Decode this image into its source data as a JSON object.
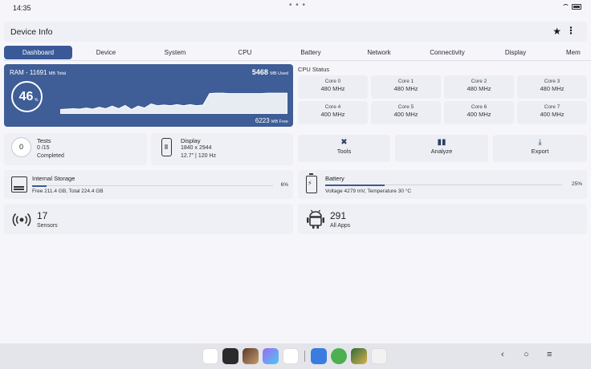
{
  "status_bar": {
    "time": "14:35",
    "dots": "• • •"
  },
  "app_bar": {
    "title": "Device Info",
    "star_icon": "star-icon",
    "more_icon": "more-vert-icon"
  },
  "tabs": [
    "Dashboard",
    "Device",
    "System",
    "CPU",
    "Battery",
    "Network",
    "Connectivity",
    "Display",
    "Mem"
  ],
  "ram": {
    "total_label": "RAM - 11691",
    "total_unit": "MB Total",
    "used_value": "5468",
    "used_unit": "MB Used",
    "free_value": "6223",
    "free_unit": "MB Free",
    "percent": "46",
    "percent_sign": "%",
    "usage_history_percent": [
      12,
      13,
      14,
      13,
      16,
      13,
      18,
      14,
      21,
      14,
      23,
      12,
      21,
      16,
      27,
      22,
      24,
      22,
      25,
      22,
      25,
      22,
      24,
      55,
      56,
      56,
      55,
      55,
      55,
      55,
      55,
      55,
      56,
      56,
      56,
      56
    ]
  },
  "cpu": {
    "title": "CPU Status",
    "cores": [
      {
        "name": "Core 0",
        "freq": "480 MHz"
      },
      {
        "name": "Core 1",
        "freq": "480 MHz"
      },
      {
        "name": "Core 2",
        "freq": "480 MHz"
      },
      {
        "name": "Core 3",
        "freq": "480 MHz"
      },
      {
        "name": "Core 4",
        "freq": "400 MHz"
      },
      {
        "name": "Core 5",
        "freq": "400 MHz"
      },
      {
        "name": "Core 6",
        "freq": "400 MHz"
      },
      {
        "name": "Core 7",
        "freq": "400 MHz"
      }
    ]
  },
  "tests": {
    "count": "0",
    "title": "Tests",
    "progress": "0 /15",
    "status": "Completed"
  },
  "display": {
    "title": "Display",
    "resolution": "1840 x 2944",
    "details": "12.7\" | 120 Hz"
  },
  "actions": [
    {
      "label": "Tools",
      "icon": "tools-icon"
    },
    {
      "label": "Analyze",
      "icon": "bar-chart-icon"
    },
    {
      "label": "Export",
      "icon": "download-icon"
    }
  ],
  "storage": {
    "title": "Internal Storage",
    "detail": "Free 211.4 GB, Total 224.4 GB",
    "percent_label": "6%",
    "fill": 0.06
  },
  "battery": {
    "title": "Battery",
    "detail": "Voltage 4279 mV, Temperature 30 °C",
    "percent_label": "25%",
    "fill": 0.25
  },
  "sensors": {
    "count": "17",
    "label": "Sensors"
  },
  "apps": {
    "count": "291",
    "label": "All Apps"
  },
  "nav": {
    "back": "‹",
    "home": "○",
    "menu": "≡"
  },
  "colors": {
    "accent": "#3a5a97",
    "ram_card": "#3f5d96",
    "card": "#eef0f5"
  }
}
